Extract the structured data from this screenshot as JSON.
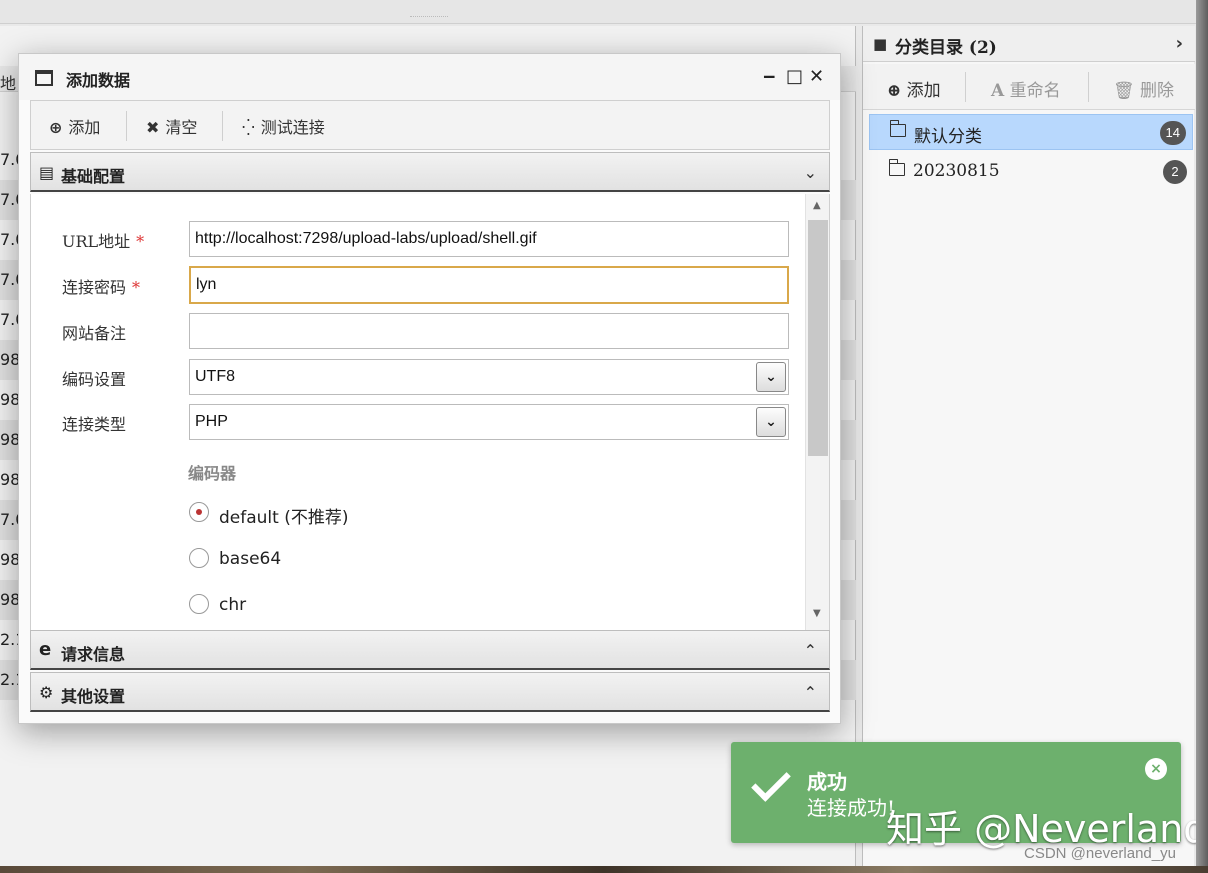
{
  "background_list": {
    "header_fragment": "地",
    "row_fragments": [
      "7.0",
      "7.0",
      "7.0",
      "7.0",
      "7.0",
      "98",
      "98",
      "98",
      "98",
      "7.0",
      "98",
      "98",
      "2.1",
      "2.1"
    ]
  },
  "dialog": {
    "title": "添加数据",
    "window_controls": {
      "minimize": "‒",
      "maximize": "□",
      "close": "✕"
    },
    "toolbar": {
      "add_label": "添加",
      "clear_label": "清空",
      "test_label": "测试连接"
    },
    "sections": {
      "basic": "基础配置",
      "request": "请求信息",
      "other": "其他设置"
    },
    "form": {
      "url_label": "URL地址",
      "url_value": "http://localhost:7298/upload-labs/upload/shell.gif",
      "password_label": "连接密码",
      "password_value": "lyn",
      "note_label": "网站备注",
      "note_value": "",
      "encoding_label": "编码设置",
      "encoding_value": "UTF8",
      "type_label": "连接类型",
      "type_value": "PHP",
      "required_mark": "*",
      "encoder_title": "编码器",
      "encoders": [
        "default (不推荐)",
        "base64",
        "chr"
      ],
      "encoder_selected": "default (不推荐)"
    }
  },
  "sidebar": {
    "title": "分类目录 (2)",
    "toolbar": {
      "add_label": "添加",
      "rename_label": "重命名",
      "delete_label": "删除"
    },
    "categories": [
      {
        "name": "默认分类",
        "count": "14"
      },
      {
        "name": "20230815",
        "count": "2"
      }
    ]
  },
  "toast": {
    "title": "成功",
    "message": "连接成功!"
  },
  "watermark": {
    "main": "知乎 @Neverland",
    "sub": "CSDN @neverland_yu"
  }
}
